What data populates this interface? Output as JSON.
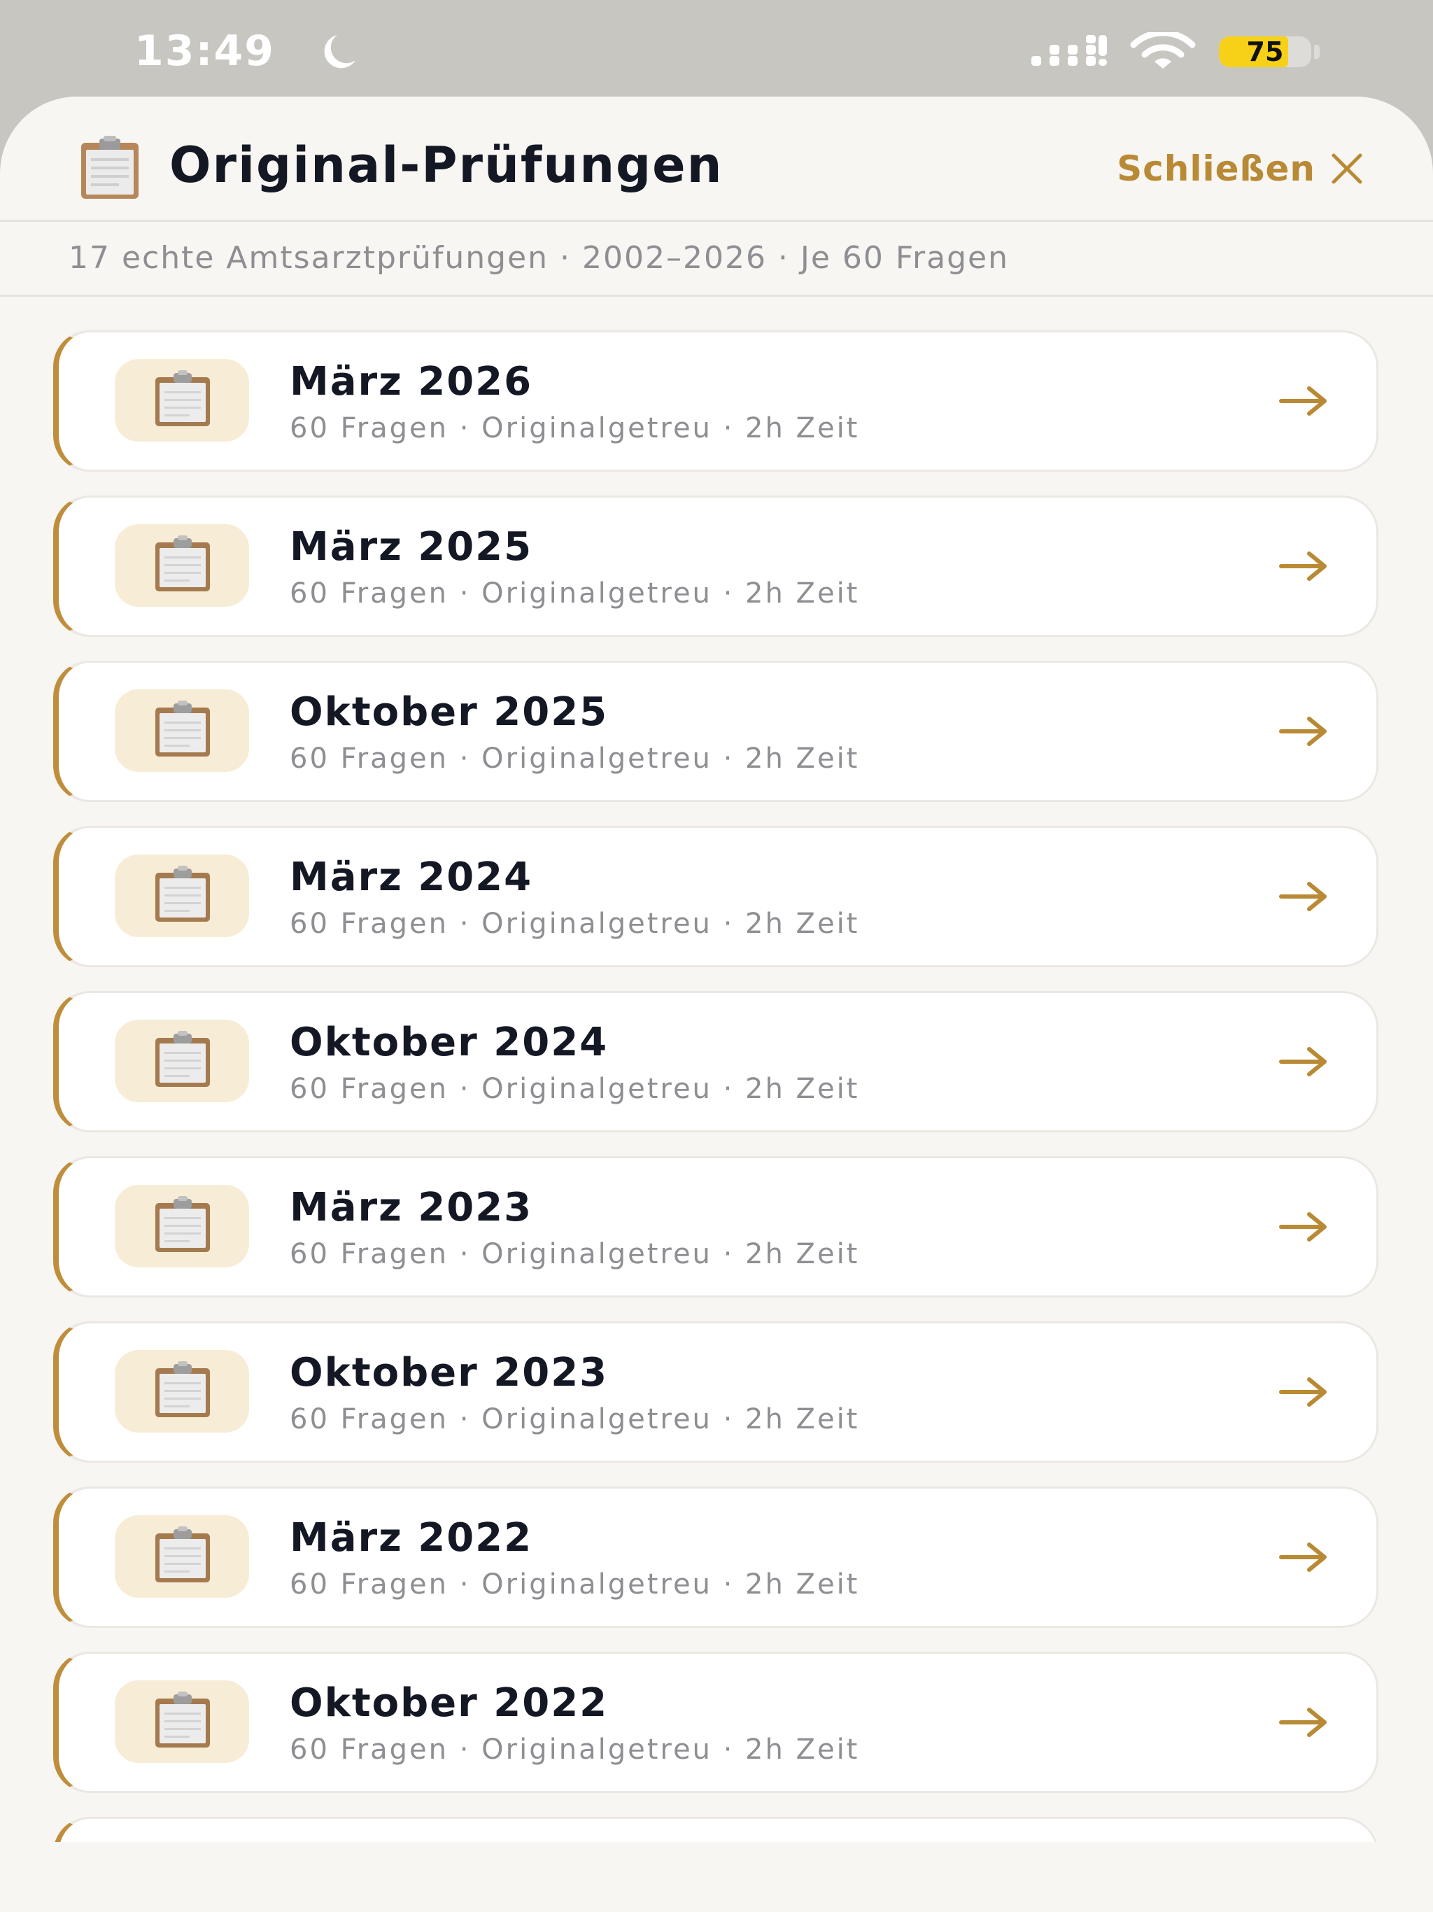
{
  "status_bar": {
    "time": "13:49",
    "battery_level": "75",
    "battery_fraction": 0.75
  },
  "header": {
    "title_icon": "clipboard-icon",
    "title": "Original-Prüfungen",
    "close_label": "Schließen",
    "close_icon": "close-x-icon"
  },
  "subtitle": "17 echte Amtsarztprüfungen · 2002–2026 · Je 60 Fragen",
  "colors": {
    "accent": "#bf8e3c",
    "accent_text": "#b98a35",
    "badge_bg": "#f7ecd6",
    "title_text": "#141824",
    "muted_text": "#8e8e93",
    "sheet_bg": "#f8f6f2",
    "status_bar_bg": "#c8c6c0"
  },
  "exams": [
    {
      "title": "März 2026",
      "meta": "60 Fragen · Originalgetreu · 2h Zeit",
      "icon": "clipboard-icon"
    },
    {
      "title": "März 2025",
      "meta": "60 Fragen · Originalgetreu · 2h Zeit",
      "icon": "clipboard-icon"
    },
    {
      "title": "Oktober 2025",
      "meta": "60 Fragen · Originalgetreu · 2h Zeit",
      "icon": "clipboard-icon"
    },
    {
      "title": "März 2024",
      "meta": "60 Fragen · Originalgetreu · 2h Zeit",
      "icon": "clipboard-icon"
    },
    {
      "title": "Oktober 2024",
      "meta": "60 Fragen · Originalgetreu · 2h Zeit",
      "icon": "clipboard-icon"
    },
    {
      "title": "März 2023",
      "meta": "60 Fragen · Originalgetreu · 2h Zeit",
      "icon": "clipboard-icon"
    },
    {
      "title": "Oktober 2023",
      "meta": "60 Fragen · Originalgetreu · 2h Zeit",
      "icon": "clipboard-icon"
    },
    {
      "title": "März 2022",
      "meta": "60 Fragen · Originalgetreu · 2h Zeit",
      "icon": "clipboard-icon"
    },
    {
      "title": "Oktober 2022",
      "meta": "60 Fragen · Originalgetreu · 2h Zeit",
      "icon": "clipboard-icon"
    }
  ]
}
